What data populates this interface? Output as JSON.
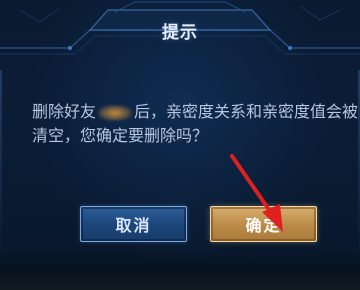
{
  "dialog": {
    "title": "提示",
    "message_line1_prefix": "删除好友",
    "message_line1_suffix": "后，亲密度关系和亲密度值会被",
    "message_line2": "清空，您确定要删除吗？",
    "redacted_icon": "blurred-name-redaction"
  },
  "buttons": {
    "cancel_label": "取消",
    "confirm_label": "确定"
  },
  "annotation": {
    "arrow_icon": "red-arrow-pointing-to-confirm",
    "arrow_color": "#e02020"
  },
  "colors": {
    "panel_bg": "#0b1d36",
    "cancel_btn": "#1d477c",
    "confirm_btn": "#b98a47",
    "text": "#b7c6df"
  }
}
